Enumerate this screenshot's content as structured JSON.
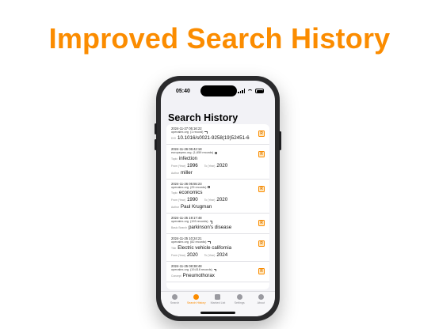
{
  "headline": "Improved Search History",
  "status_bar": {
    "time": "05:40"
  },
  "screen_title": "Search History",
  "records": [
    {
      "date": "2024-11-27 05:16:22",
      "source": "openalex.org",
      "count": "(1 record)",
      "access": "open",
      "fields": [
        [
          {
            "label": "DOI",
            "value": "10.1016/s0021-9258(19)52451-6"
          }
        ]
      ],
      "badge": "R"
    },
    {
      "date": "2024-11-26 06:42:18",
      "source": "europepmc.org",
      "count": "(1,659 records)",
      "access": "lock",
      "fields": [
        [
          {
            "label": "Topic",
            "value": "infection"
          }
        ],
        [
          {
            "label": "From (Year)",
            "value": "1996"
          },
          {
            "label": "To (Year)",
            "value": "2020"
          }
        ],
        [
          {
            "label": "Author",
            "value": "miller"
          }
        ]
      ],
      "badge": "R"
    },
    {
      "date": "2024-11-26 05:55:23",
      "source": "openalex.org",
      "count": "(25 records)",
      "access": "lock",
      "fields": [
        [
          {
            "label": "Topic",
            "value": "economics"
          }
        ],
        [
          {
            "label": "From (Year)",
            "value": "1990"
          },
          {
            "label": "To (Year)",
            "value": "2020"
          }
        ],
        [
          {
            "label": "Author",
            "value": "Paul Krugman"
          }
        ]
      ],
      "badge": "R"
    },
    {
      "date": "2024-11-25 19:17:48",
      "source": "openalex.org",
      "count": "(193 records)",
      "access": "open",
      "fields": [
        [
          {
            "label": "Basic Search",
            "value": "parkinson's disease"
          }
        ]
      ],
      "badge": "R"
    },
    {
      "date": "2024-11-25 10:24:21",
      "source": "openalex.org",
      "count": "(82 records)",
      "access": "open",
      "fields": [
        [
          {
            "label": "Title",
            "value": "Electric vehicle california"
          }
        ],
        [
          {
            "label": "From (Year)",
            "value": "2020"
          },
          {
            "label": "To (Year)",
            "value": "2024"
          }
        ]
      ],
      "badge": "R"
    },
    {
      "date": "2024-11-25 08:38:48",
      "source": "openalex.org",
      "count": "(19,618 records)",
      "access": "open",
      "fields": [
        [
          {
            "label": "Concept",
            "value": "Pneumothorax"
          }
        ]
      ],
      "badge": "R"
    }
  ],
  "tabs": [
    {
      "label": "Search",
      "icon": "search-icon",
      "active": false
    },
    {
      "label": "Search History",
      "icon": "history-icon",
      "active": true
    },
    {
      "label": "Marked List",
      "icon": "marked-list-icon",
      "active": false
    },
    {
      "label": "Settings",
      "icon": "gear-icon",
      "active": false
    },
    {
      "label": "About",
      "icon": "info-icon",
      "active": false
    }
  ],
  "colors": {
    "accent": "#fb8c00",
    "badge_bg": "#ffe7bf"
  }
}
